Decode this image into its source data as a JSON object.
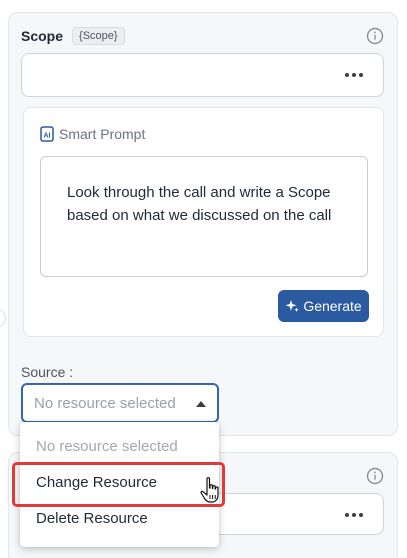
{
  "scope": {
    "title": "Scope",
    "chip": "{Scope}",
    "input_value": ""
  },
  "smart_prompt": {
    "label": "Smart Prompt",
    "text": "Look through the call and write a Scope based on what we discussed on the call",
    "generate_label": "Generate"
  },
  "source": {
    "label": "Source :",
    "selected": "No resource selected",
    "options": [
      {
        "label": "No resource selected",
        "disabled": true
      },
      {
        "label": "Change Resource",
        "disabled": false
      },
      {
        "label": "Delete Resource",
        "disabled": false
      }
    ]
  },
  "icons": {
    "info": "info-icon",
    "more": "more-dots-icon",
    "ai": "ai-document-icon",
    "sparkle": "sparkle-icon",
    "caret": "caret-up-icon",
    "cursor": "hand-pointer-icon"
  },
  "colors": {
    "accent": "#2b5aa0",
    "focus_border": "#2f66b8",
    "highlight": "#e03a3a"
  }
}
